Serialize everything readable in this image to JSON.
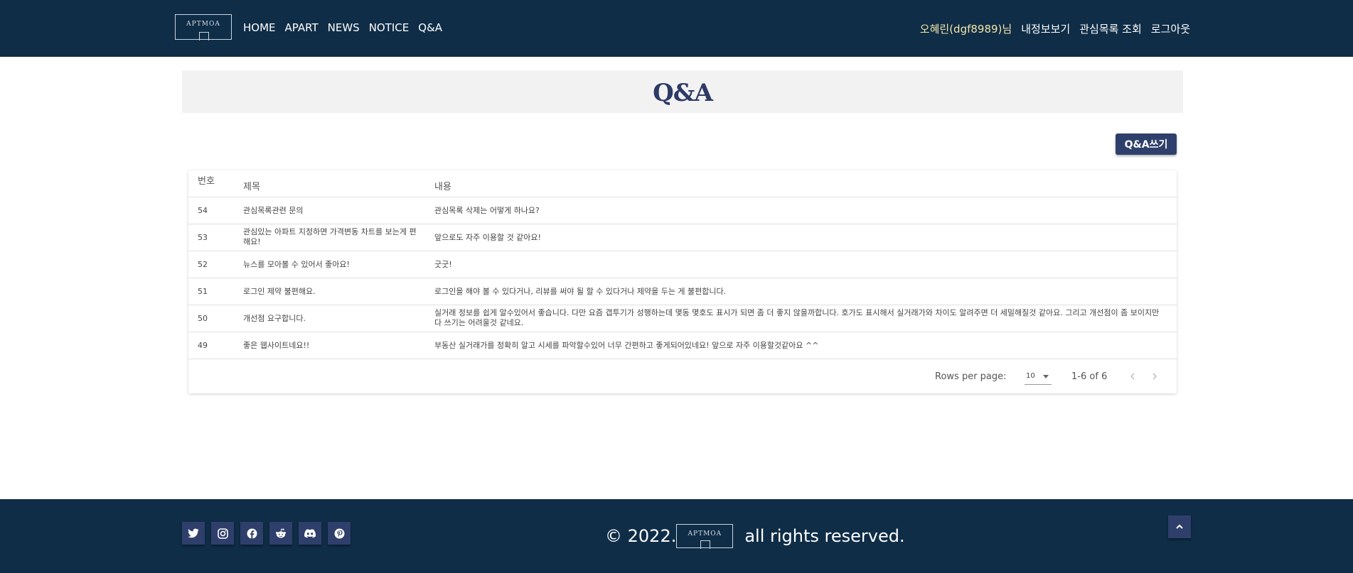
{
  "header": {
    "logo_text": "APTMOA",
    "nav": [
      "HOME",
      "APART",
      "NEWS",
      "NOTICE",
      "Q&A"
    ],
    "user_name": "오혜린(dgf8989)님",
    "user_links": [
      "내정보보기",
      "관심목록 조회",
      "로그아웃"
    ]
  },
  "page": {
    "title": "Q&A",
    "write_button": "Q&A쓰기"
  },
  "table": {
    "headers": [
      "번호",
      "제목",
      "내용"
    ],
    "rows": [
      {
        "num": "54",
        "title": "관심목록관련 문의",
        "content": "관심목록 삭제는 어떻게 하나요?"
      },
      {
        "num": "53",
        "title": "관심있는 아파트 지정하면 가격변동 차트를 보는게 편해요!",
        "content": "앞으로도 자주 이용할 것 같아요!"
      },
      {
        "num": "52",
        "title": "뉴스를 모아볼 수 있어서 좋아요!",
        "content": "굿굿!"
      },
      {
        "num": "51",
        "title": "로그인 제약 불편해요.",
        "content": "로그인을 해야 볼 수 있다거나, 리뷰를 써야 될 할 수 있다거나 제약을 두는 게 불편합니다."
      },
      {
        "num": "50",
        "title": "개선점 요구합니다.",
        "content": "실거래 정보를 쉽게 알수있어서 좋습니다. 다만 요즘 갭투기가 성행하는데 몇동 몇호도 표시가 되면 좀 더 좋지 않을까합니다. 호가도 표시해서 실거래가와 차이도 알려주면 더 세밀해질것 같아요. 그리고 개선점이 좀 보이지만 다 쓰기는 어려울것 같네요."
      },
      {
        "num": "49",
        "title": "좋은 웹사이트네요!!",
        "content": "부동산 실거래가를 정확히 알고 시세를 파악할수있어 너무 간편하고 좋게되어있네요! 앞으로 자주 이용할것같아요 ^^"
      }
    ],
    "rows_per_page_label": "Rows per page:",
    "rows_per_page_value": "10",
    "range": "1-6 of 6"
  },
  "footer": {
    "copyright_prefix": "© 2022.",
    "logo_text": "APTMOA",
    "copyright_suffix": "all rights reserved.",
    "social_icons": [
      "twitter-icon",
      "instagram-icon",
      "facebook-icon",
      "reddit-icon",
      "discord-icon",
      "pinterest-icon"
    ]
  },
  "colors": {
    "header_bg": "#0f2d47",
    "accent": "#2f3f6b",
    "username": "#f2e6a8",
    "banner_bg": "#f2f2f2"
  }
}
